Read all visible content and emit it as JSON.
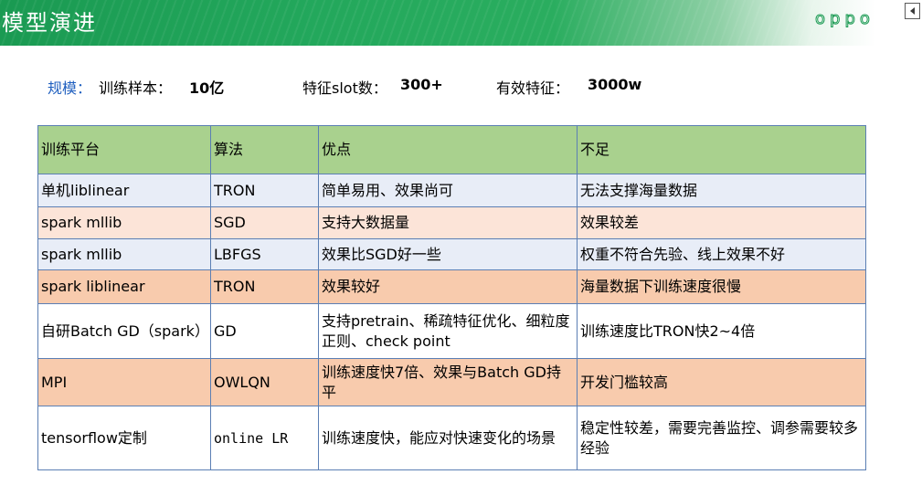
{
  "header": {
    "title": "模型演进",
    "brand": "oppo",
    "colors": {
      "header_green": "#1a9a52",
      "table_header_green": "#a9d18e",
      "row_blue": "#e8edf7",
      "row_pink": "#fce4d8",
      "row_orange": "#f8cbad",
      "label_blue": "#1f5fbf"
    }
  },
  "stats": {
    "scale_label": "规模：",
    "samples_label": "训练样本：",
    "samples_value": "10亿",
    "slots_label": "特征slot数：",
    "slots_value": "300+",
    "features_label": "有效特征：",
    "features_value": "3000w"
  },
  "table": {
    "headers": [
      "训练平台",
      "算法",
      "优点",
      "不足"
    ],
    "rows": [
      {
        "platform": "单机liblinear",
        "algorithm": "TRON",
        "pros": "简单易用、效果尚可",
        "cons": "无法支撑海量数据"
      },
      {
        "platform": "spark mllib",
        "algorithm": "SGD",
        "pros": "支持大数据量",
        "cons": "效果较差"
      },
      {
        "platform": "spark mllib",
        "algorithm": "LBFGS",
        "pros": "效果比SGD好一些",
        "cons": "权重不符合先验、线上效果不好"
      },
      {
        "platform": "spark liblinear",
        "algorithm": "TRON",
        "pros": "效果较好",
        "cons": "海量数据下训练速度很慢"
      },
      {
        "platform": "自研Batch GD（spark）",
        "algorithm": "GD",
        "pros": "支持pretrain、稀疏特征优化、细粒度正则、check point",
        "cons": "训练速度比TRON快2~4倍"
      },
      {
        "platform": "MPI",
        "algorithm": "OWLQN",
        "pros": "训练速度快7倍、效果与Batch GD持平",
        "cons": "开发门槛较高"
      },
      {
        "platform": "tensorflow定制",
        "algorithm": "online LR",
        "pros": "训练速度快，能应对快速变化的场景",
        "cons": "稳定性较差，需要完善监控、调参需要较多经验"
      }
    ]
  }
}
